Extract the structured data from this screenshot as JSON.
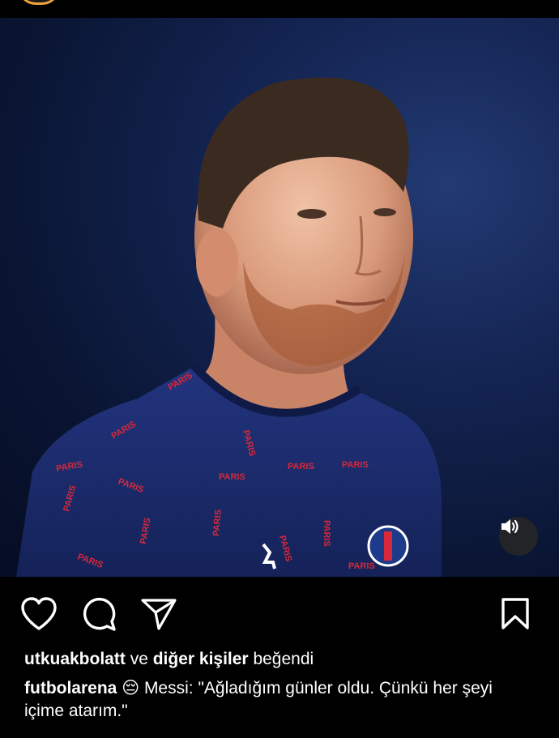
{
  "post": {
    "liked_by_user": "utkuakbolatt",
    "liked_by_connector": "ve",
    "liked_by_others": "diğer kişiler",
    "liked_by_suffix": "beğendi",
    "caption_user": "futbolarena",
    "caption_emoji": "😔",
    "caption_text": "Messi: \"Ağladığım günler oldu. Çünkü her şeyi içime atarım.\""
  },
  "media": {
    "alt": "Messi in PSG training shirt",
    "shirt_print": "PARIS"
  },
  "icons": {
    "like": "heart-icon",
    "comment": "comment-icon",
    "share": "send-icon",
    "save": "bookmark-icon",
    "volume": "speaker-icon"
  },
  "colors": {
    "background": "#000000",
    "text": "#ffffff",
    "shirt_navy": "#1b2a6b",
    "shirt_print_red": "#d8283a",
    "story_ring": "#f2a33a"
  }
}
